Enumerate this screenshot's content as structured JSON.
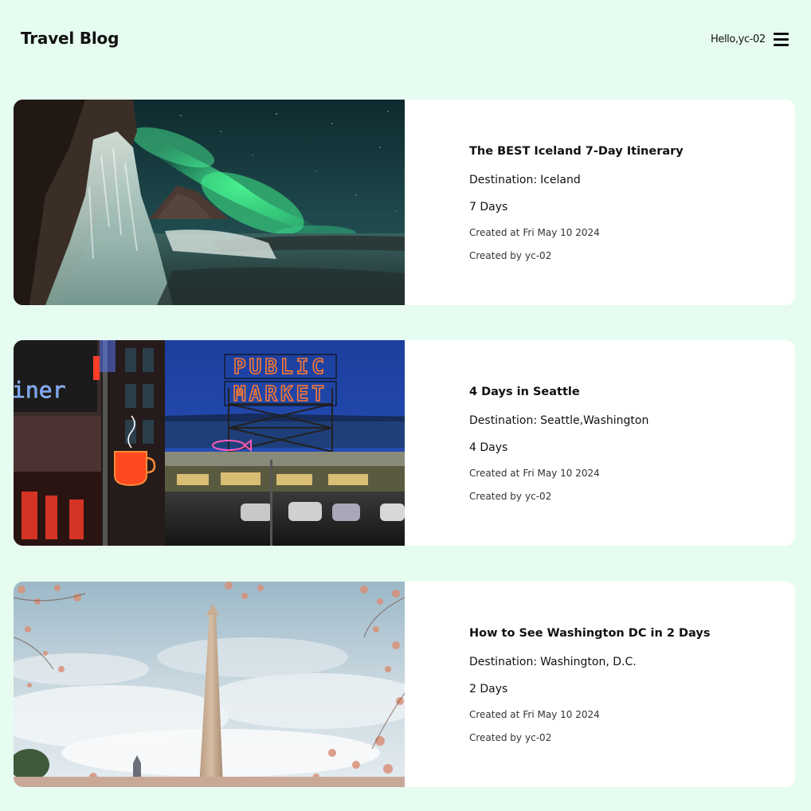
{
  "header": {
    "title": "Travel Blog",
    "greeting": "Hello,yc-02",
    "menu_icon": "hamburger-menu-icon"
  },
  "posts": [
    {
      "title": "The BEST Iceland 7-Day Itinerary",
      "destination_label": "Destination:",
      "destination": "Iceland",
      "duration": "7 Days",
      "created_label": "Created at",
      "created": "Fri May 10 2024",
      "author_label": "Created by",
      "author": "yc-02",
      "image": "aurora-over-iceland-coast"
    },
    {
      "title": "4 Days in Seattle",
      "destination_label": "Destination:",
      "destination": "Seattle,Washington",
      "duration": "4 Days",
      "created_label": "Created at",
      "created": "Fri May 10 2024",
      "author_label": "Created by",
      "author": "yc-02",
      "image": "pike-place-public-market-neon-sign",
      "image_text": {
        "sign_line1": "PUBLIC",
        "sign_line2": "MARKET",
        "diner": "iner"
      }
    },
    {
      "title": "How to See Washington DC in 2 Days",
      "destination_label": "Destination:",
      "destination": "Washington, D.C.",
      "duration": "2 Days",
      "created_label": "Created at",
      "created": "Fri May 10 2024",
      "author_label": "Created by",
      "author": "yc-02",
      "image": "washington-monument-cherry-blossoms"
    }
  ],
  "colors": {
    "page_background": "#e6fcf0",
    "card_background": "#ffffff",
    "text": "#111111"
  }
}
